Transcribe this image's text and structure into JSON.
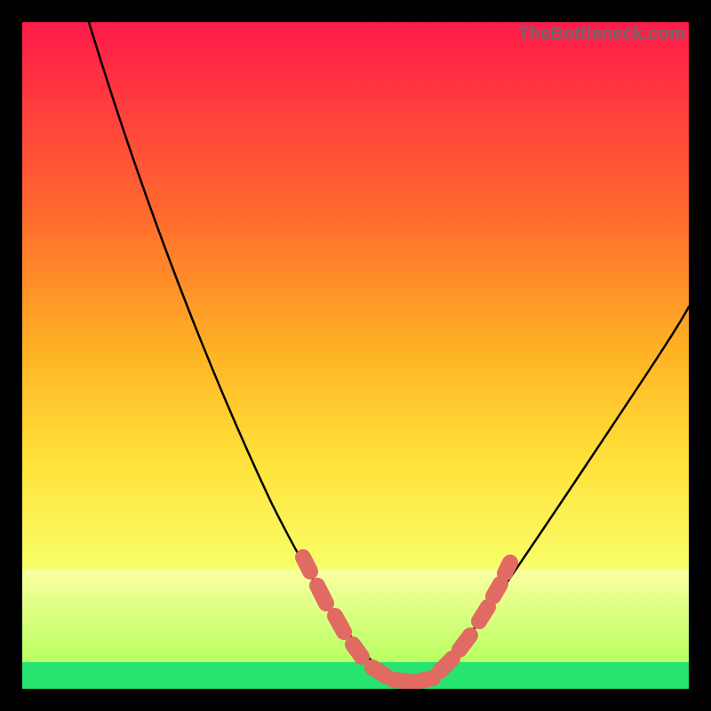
{
  "watermark": "TheBottleneck.com",
  "chart_data": {
    "type": "line",
    "title": "",
    "xlabel": "",
    "ylabel": "",
    "xlim": [
      0,
      100
    ],
    "ylim": [
      0,
      100
    ],
    "series": [
      {
        "name": "bottleneck-curve",
        "x": [
          10,
          15,
          20,
          25,
          30,
          35,
          40,
          45,
          50,
          52,
          55,
          58,
          60,
          62,
          65,
          70,
          75,
          80,
          85,
          90,
          95,
          100
        ],
        "y": [
          100,
          90,
          80,
          70,
          60,
          50,
          40,
          30,
          18,
          12,
          6,
          2,
          0,
          2,
          5,
          12,
          20,
          28,
          36,
          44,
          52,
          60
        ]
      }
    ],
    "markers": {
      "name": "highlight-points",
      "color": "#e16a63",
      "x": [
        42,
        44,
        46,
        48,
        52,
        54,
        56,
        58,
        60,
        62,
        64,
        66,
        68,
        70,
        71
      ],
      "y": [
        36,
        32,
        26,
        22,
        9,
        6,
        4,
        2,
        0,
        2,
        4,
        7,
        10,
        15,
        22
      ]
    },
    "optimal_band": {
      "y_from": 0,
      "y_to": 4,
      "color": "#2ee070"
    },
    "near_optimal_band": {
      "y_from": 4,
      "y_to": 18,
      "color_top": "#f8ff76",
      "color_bottom": "#b8ff5e"
    },
    "background_gradient": {
      "top": "#ff1a4a",
      "mid": "#ffc728",
      "bottom": "#f8ff76"
    }
  }
}
